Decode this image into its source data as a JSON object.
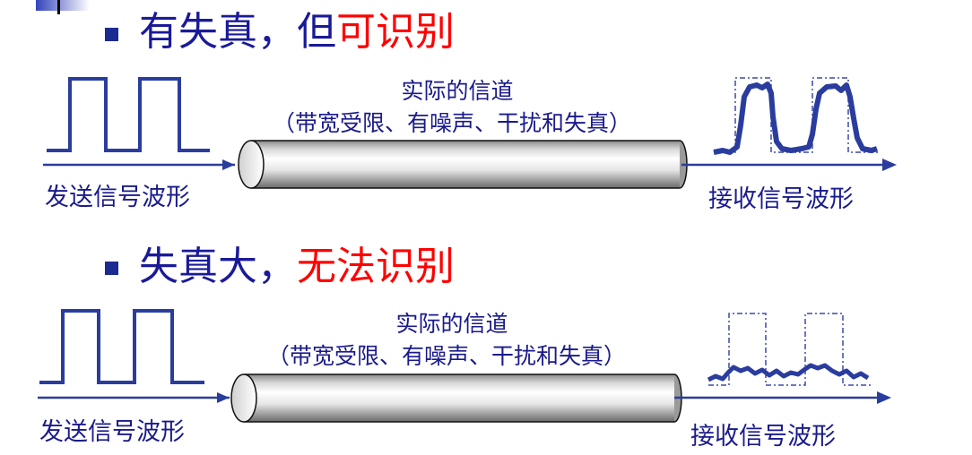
{
  "colors": {
    "wave": "#2a3d9e",
    "heading": "#1a1a99",
    "highlight": "#ff0000",
    "text": "#1a1a8c"
  },
  "section1": {
    "heading_prefix": "有失真，但",
    "heading_highlight": "可识别",
    "channel_title": "实际的信道",
    "channel_desc": "（带宽受限、有噪声、干扰和失真）",
    "send_label": "发送信号波形",
    "recv_label": "接收信号波形"
  },
  "section2": {
    "heading_prefix": "失真大，",
    "heading_highlight": "无法识别",
    "channel_title": "实际的信道",
    "channel_desc": "（带宽受限、有噪声、干扰和失真）",
    "send_label": "发送信号波形",
    "recv_label": "接收信号波形"
  }
}
